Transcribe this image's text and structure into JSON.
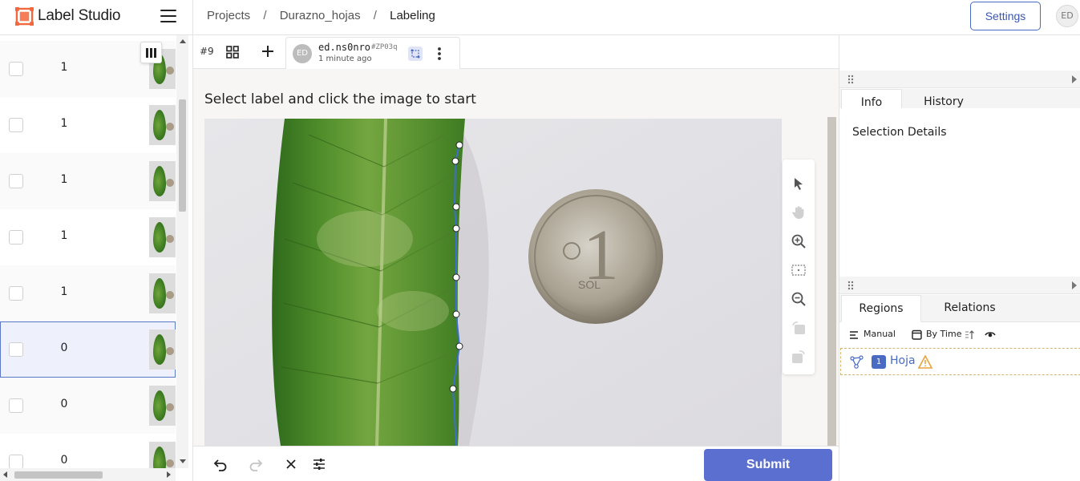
{
  "app": {
    "name": "Label Studio"
  },
  "breadcrumb": [
    {
      "label": "Projects"
    },
    {
      "label": "Durazno_hojas"
    },
    {
      "label": "Labeling"
    }
  ],
  "breadcrumb_sep": "/",
  "header": {
    "settings_label": "Settings",
    "avatar_initials": "ED"
  },
  "tasks": [
    {
      "count": "1"
    },
    {
      "count": "1"
    },
    {
      "count": "1"
    },
    {
      "count": "1"
    },
    {
      "count": "1"
    },
    {
      "count": "0"
    },
    {
      "count": "0"
    },
    {
      "count": "0"
    }
  ],
  "annotation": {
    "task_id": "#9",
    "user": "ed.ns0nro",
    "hash": "#ZP03q",
    "time": "1 minute ago",
    "avatar_initials": "ED"
  },
  "main": {
    "instruction": "Select label and click the image to start"
  },
  "bottom": {
    "submit_label": "Submit"
  },
  "right": {
    "tab_info": "Info",
    "tab_history": "History",
    "selection_details": "Selection Details",
    "tab_regions": "Regions",
    "tab_relations": "Relations",
    "order_manual": "Manual",
    "order_by_time": "By Time",
    "region": {
      "index": "1",
      "label": "Hoja"
    }
  },
  "colors": {
    "accent": "#5b6fd1",
    "region_label": "#4a6bc4",
    "warning": "#e8a33d",
    "polygon": "#3a6fd1"
  }
}
